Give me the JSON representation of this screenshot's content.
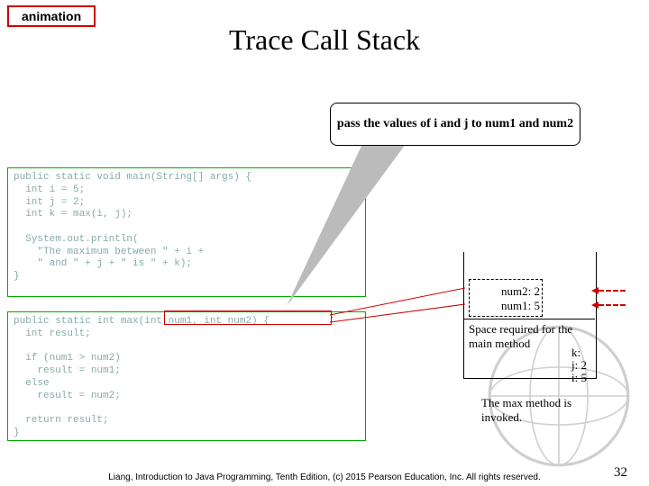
{
  "tag": "animation",
  "title": "Trace Call Stack",
  "callout": "pass the values of i and j to num1 and num2",
  "code_main": "public static void main(String[] args) {\n  int i = 5;\n  int j = 2;\n  int k = max(i, j);\n\n  System.out.println(\n    \"The maximum between \" + i +\n    \" and \" + j + \" is \" + k);\n}",
  "code_max": "public static int max(int num1, int num2) {\n  int result;\n\n  if (num1 > num2)\n    result = num1;\n  else\n    result = num2;\n\n  return result;\n}",
  "stack": {
    "num2": "num2: 2",
    "num1": "num1: 5",
    "space_label": "Space required for the main method",
    "k": "k:",
    "j": "j: 2",
    "i": "i: 5"
  },
  "invoked": "The max method is invoked.",
  "footer": "Liang, Introduction to Java Programming, Tenth Edition, (c) 2015 Pearson Education, Inc. All rights reserved.",
  "page": "32"
}
